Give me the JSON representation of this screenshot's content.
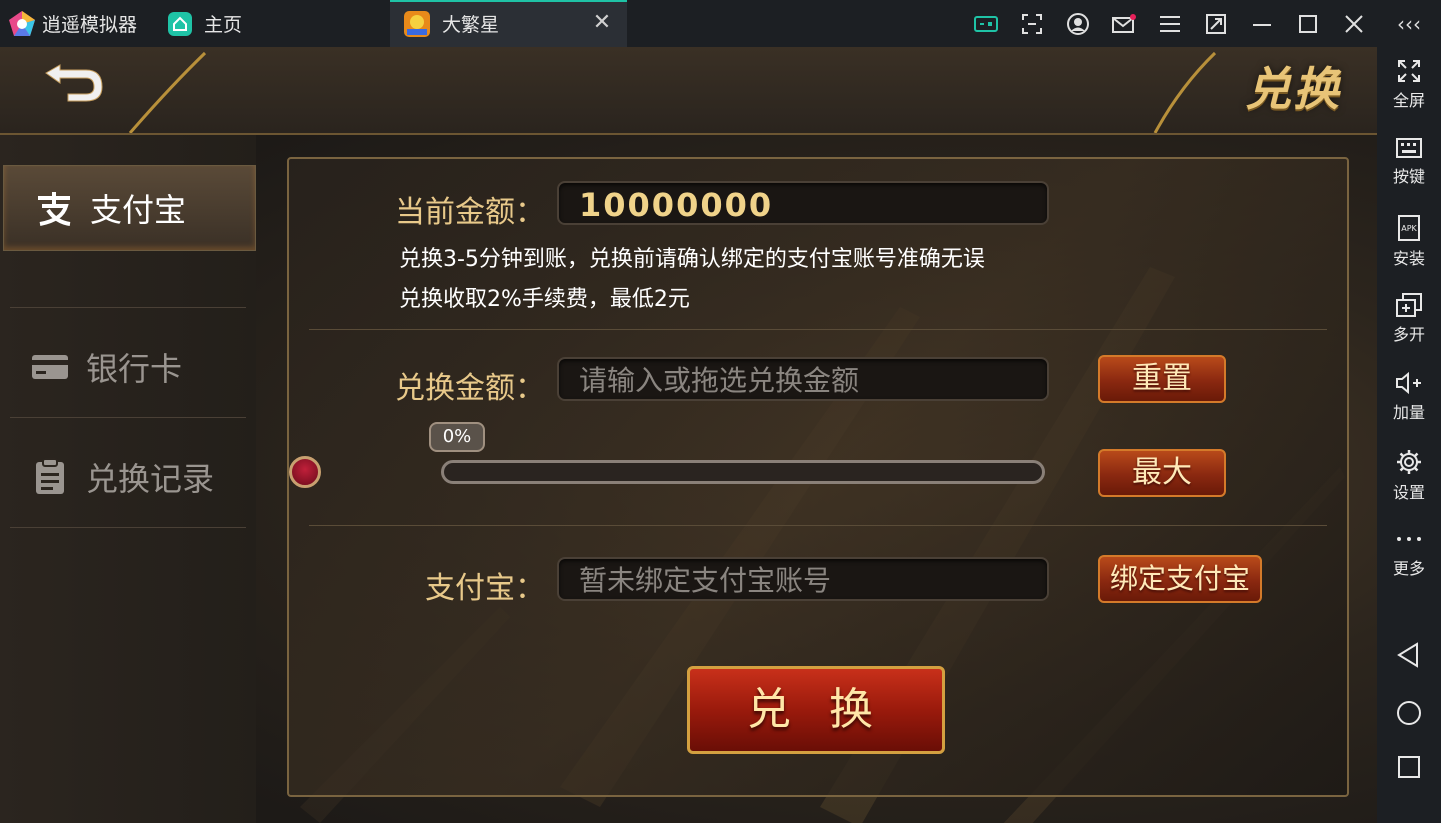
{
  "titlebar": {
    "app_name": "逍遥模拟器",
    "home_tab": "主页",
    "game_tab": "大繁星",
    "tab_close": "✕"
  },
  "sidebar": {
    "collapse": "‹‹‹",
    "items": [
      {
        "label": "全屏",
        "icon": "fullscreen-icon"
      },
      {
        "label": "按键",
        "icon": "keyboard-icon"
      },
      {
        "label": "安装",
        "icon": "apk-icon"
      },
      {
        "label": "多开",
        "icon": "multi-instance-icon"
      },
      {
        "label": "加量",
        "icon": "volume-up-icon"
      },
      {
        "label": "设置",
        "icon": "gear-icon"
      },
      {
        "label": "更多",
        "icon": "more-icon"
      }
    ]
  },
  "game": {
    "title": "兑换",
    "menu": [
      {
        "label": "支付宝",
        "icon": "alipay-icon",
        "active": true
      },
      {
        "label": "银行卡",
        "icon": "bank-card-icon",
        "active": false
      },
      {
        "label": "兑换记录",
        "icon": "clipboard-icon",
        "active": false
      }
    ],
    "balance": {
      "label": "当前金额：",
      "value": "10000000"
    },
    "notes": [
      "兑换3-5分钟到账，兑换前请确认绑定的支付宝账号准确无误",
      "兑换收取2%手续费，最低2元"
    ],
    "amount": {
      "label": "兑换金额：",
      "placeholder": "请输入或拖选兑换金额",
      "reset": "重置",
      "max": "最大"
    },
    "slider": {
      "percent_label": "0%",
      "fraction": 0
    },
    "account": {
      "label": "支付宝：",
      "value": "暂未绑定支付宝账号",
      "bind": "绑定支付宝"
    },
    "submit": "兑 换"
  },
  "colors": {
    "accent": "#1fc3a6",
    "gold": "#e8c98a",
    "red_button": "#9a1a0c"
  }
}
